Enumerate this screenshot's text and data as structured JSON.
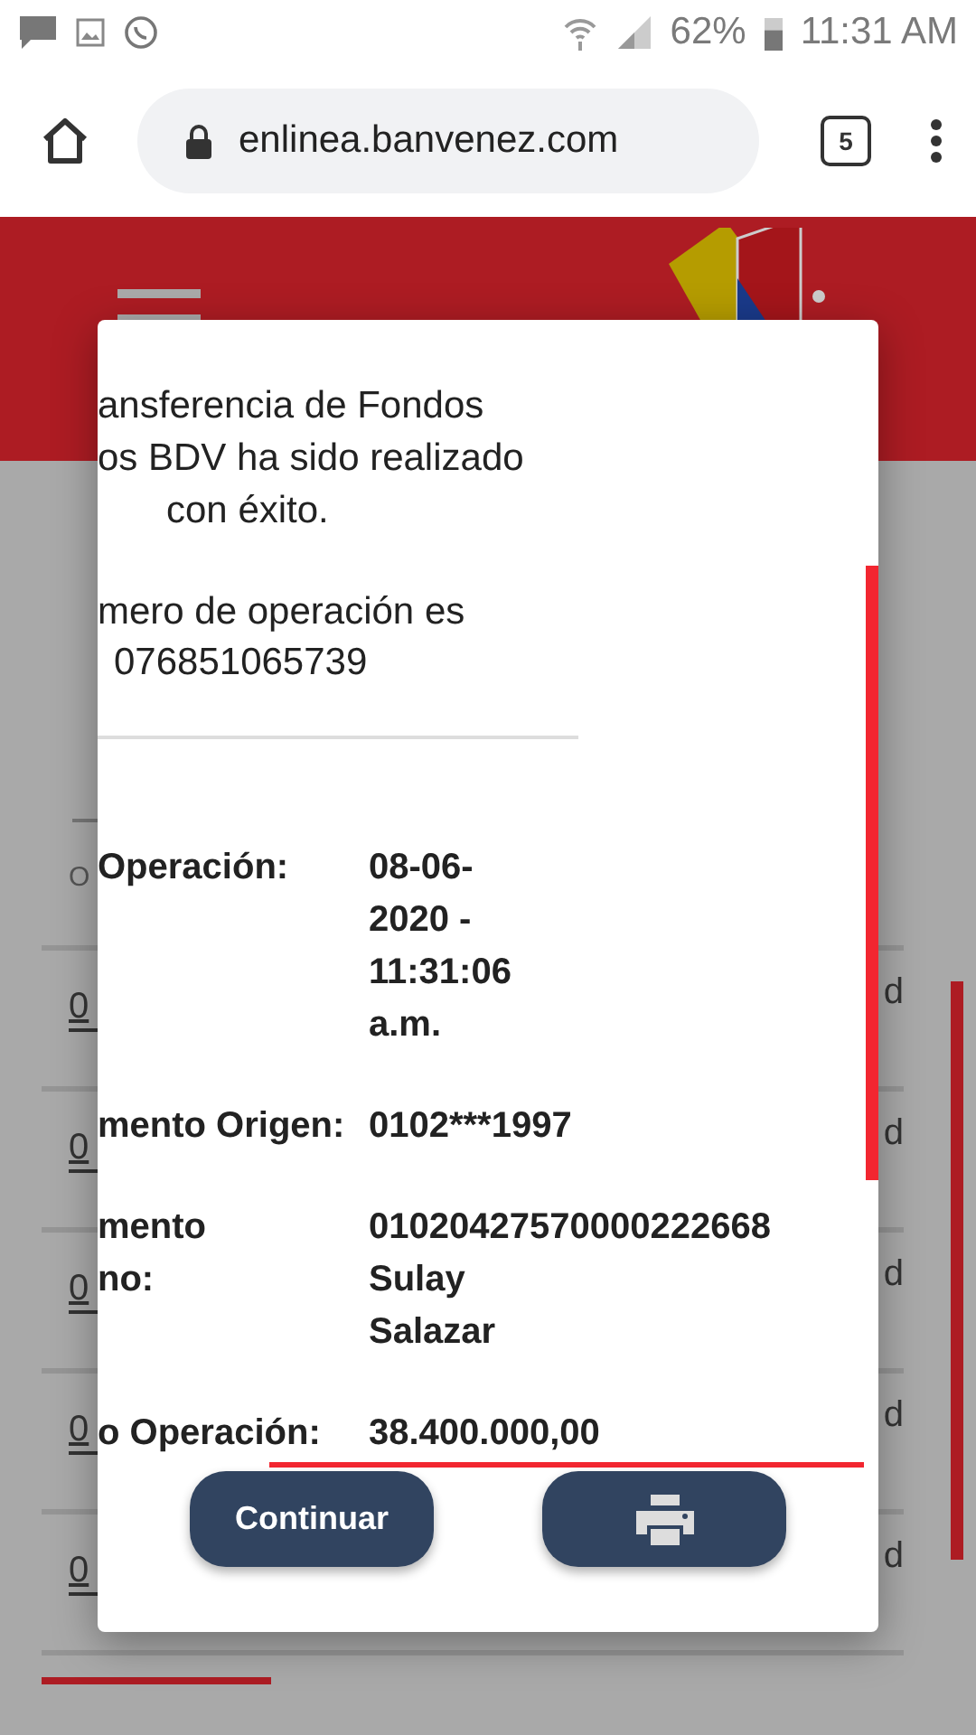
{
  "status_bar": {
    "battery": "62%",
    "time": "11:31 AM"
  },
  "browser": {
    "url": "enlinea.banvenez.com",
    "tab_count": "5"
  },
  "page": {
    "subheading": "O",
    "rows": [
      {
        "link": "0",
        "column_2": "d"
      },
      {
        "link": "0",
        "column_2": "d"
      },
      {
        "link": "0",
        "column_2": "d"
      },
      {
        "link": "0",
        "column_2": "d"
      },
      {
        "link": "0",
        "column_2": "d"
      }
    ]
  },
  "dialog": {
    "message_lines": [
      "ansferencia de Fondos",
      "os BDV ha sido realizado",
      "con éxito."
    ],
    "operation_lines": [
      "mero de operación es",
      "076851065739"
    ],
    "details": [
      {
        "label_lines": [
          "Operación:"
        ],
        "value_lines": [
          "08-06-",
          "2020 -",
          "11:31:06",
          "a.m."
        ]
      },
      {
        "label_lines": [
          "mento Origen:"
        ],
        "value_lines": [
          "0102***1997"
        ]
      },
      {
        "label_lines": [
          "mento",
          "no:"
        ],
        "value_lines": [
          "01020427570000222668",
          "Sulay",
          "Salazar"
        ]
      },
      {
        "label_lines": [
          "o Operación:"
        ],
        "value_lines": [
          "38.400.000,00"
        ]
      }
    ],
    "buttons": [
      {
        "kind": "text",
        "label": "Continuar"
      },
      {
        "kind": "print"
      }
    ]
  }
}
